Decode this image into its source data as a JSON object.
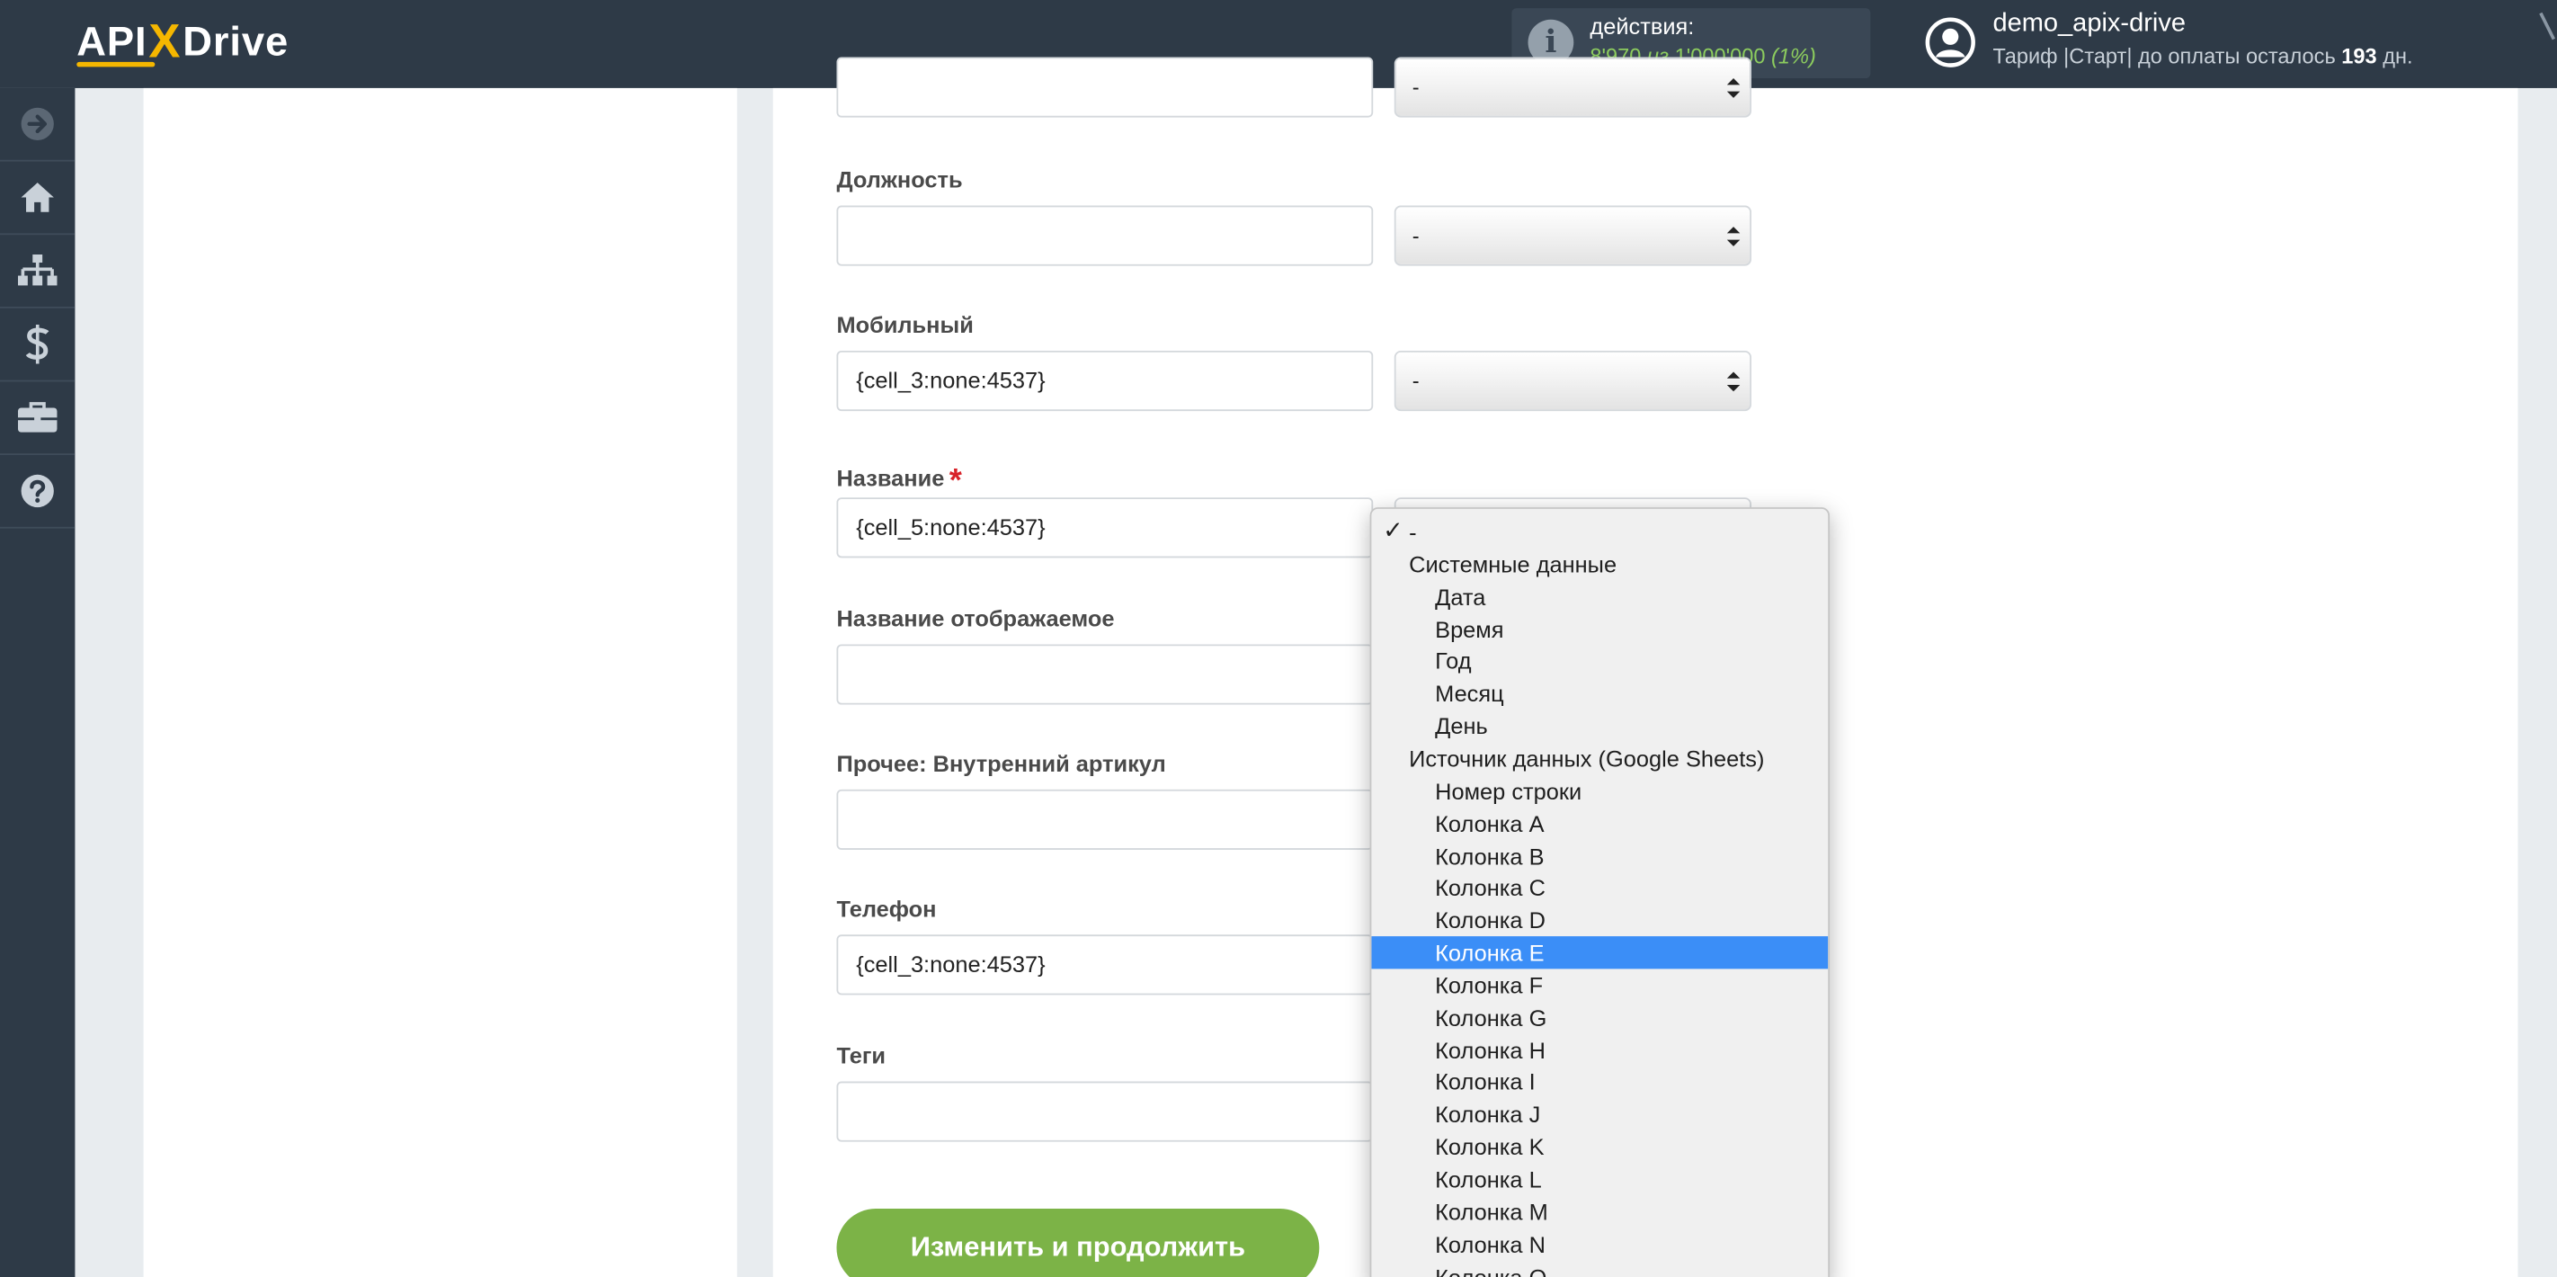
{
  "header": {
    "logo": {
      "part1": "API",
      "x": "X",
      "part2": "Drive"
    },
    "actions": {
      "label": "действия:",
      "used": "8'970",
      "of": "из",
      "total": "1'000'000",
      "percent": "(1%)"
    },
    "user": {
      "name": "demo_apix-drive",
      "plan_prefix": "Тариф |Старт| до оплаты осталось",
      "days": "193",
      "days_suffix": "дн."
    }
  },
  "sidebar": {
    "items": [
      {
        "icon": "arrow-right-circle-icon"
      },
      {
        "icon": "home-icon"
      },
      {
        "icon": "sitemap-icon"
      },
      {
        "icon": "dollar-icon"
      },
      {
        "icon": "briefcase-icon"
      },
      {
        "icon": "question-icon"
      }
    ]
  },
  "form": {
    "top_select_value": "-",
    "fields": [
      {
        "label": "Должность",
        "value": "",
        "select": "-"
      },
      {
        "label": "Мобильный",
        "value": "{cell_3:none:4537}",
        "select": "-"
      },
      {
        "label": "Название",
        "required_mark": "*",
        "value": "{cell_5:none:4537}"
      },
      {
        "label": "Название отображаемое",
        "value": ""
      },
      {
        "label": "Прочее: Внутренний артикул",
        "value": ""
      },
      {
        "label": "Телефон",
        "value": "{cell_3:none:4537}"
      },
      {
        "label": "Теги",
        "value": ""
      }
    ],
    "submit_label": "Изменить и продолжить"
  },
  "dropdown": {
    "check_mark": "✓",
    "items": [
      {
        "label": "-",
        "kind": "first",
        "checked": true
      },
      {
        "label": "Системные данные",
        "kind": "group"
      },
      {
        "label": "Дата",
        "kind": "opt"
      },
      {
        "label": "Время",
        "kind": "opt"
      },
      {
        "label": "Год",
        "kind": "opt"
      },
      {
        "label": "Месяц",
        "kind": "opt"
      },
      {
        "label": "День",
        "kind": "opt"
      },
      {
        "label": "Источник данных (Google Sheets)",
        "kind": "group"
      },
      {
        "label": "Номер строки",
        "kind": "opt"
      },
      {
        "label": "Колонка A",
        "kind": "opt"
      },
      {
        "label": "Колонка B",
        "kind": "opt"
      },
      {
        "label": "Колонка C",
        "kind": "opt"
      },
      {
        "label": "Колонка D",
        "kind": "opt"
      },
      {
        "label": "Колонка E",
        "kind": "opt",
        "highlighted": true
      },
      {
        "label": "Колонка F",
        "kind": "opt"
      },
      {
        "label": "Колонка G",
        "kind": "opt"
      },
      {
        "label": "Колонка H",
        "kind": "opt"
      },
      {
        "label": "Колонка I",
        "kind": "opt"
      },
      {
        "label": "Колонка J",
        "kind": "opt"
      },
      {
        "label": "Колонка K",
        "kind": "opt"
      },
      {
        "label": "Колонка L",
        "kind": "opt"
      },
      {
        "label": "Колонка M",
        "kind": "opt"
      },
      {
        "label": "Колонка N",
        "kind": "opt"
      },
      {
        "label": "Колонка O",
        "kind": "opt"
      }
    ]
  },
  "colors": {
    "topbar": "#2e3a47",
    "accent_yellow": "#f5b700",
    "actions_green": "#8ccc5e",
    "button_green": "#7cb347",
    "highlight_blue": "#3b8ef7",
    "required_red": "#d8232a"
  }
}
